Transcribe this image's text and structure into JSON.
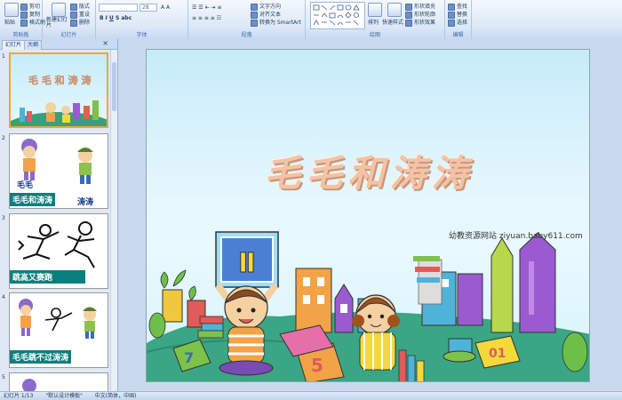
{
  "ribbon": {
    "clipboard": {
      "title": "剪贴板",
      "paste": "粘贴",
      "cut": "剪切",
      "copy": "复制",
      "format_painter": "格式刷"
    },
    "slides": {
      "title": "幻灯片",
      "new_slide": "新建幻灯片",
      "layout": "版式",
      "reset": "重设",
      "delete": "删除"
    },
    "font": {
      "title": "字体",
      "font_name": "",
      "font_size": "28"
    },
    "paragraph": {
      "title": "段落",
      "text_direction": "文字方向",
      "align_text": "对齐文本",
      "smartart": "转换为 SmartArt"
    },
    "drawing": {
      "title": "绘图",
      "arrange": "排列",
      "quick_styles": "快速样式",
      "shape_fill": "形状填充",
      "shape_outline": "形状轮廓",
      "shape_effects": "形状效果"
    },
    "editing": {
      "title": "编辑",
      "find": "查找",
      "replace": "替换",
      "select": "选择"
    }
  },
  "panel": {
    "tabs": [
      "幻灯片",
      "大纲"
    ],
    "slides": [
      {
        "num": "1",
        "label": ""
      },
      {
        "num": "2",
        "label": "毛毛和涛涛",
        "name1": "毛毛",
        "name2": "涛涛"
      },
      {
        "num": "3",
        "label": "跳高又赛跑"
      },
      {
        "num": "4",
        "label": "毛毛跳不过涛涛"
      },
      {
        "num": "5",
        "label": ""
      }
    ]
  },
  "slide": {
    "title": "毛毛和涛涛",
    "site": "幼教资源网站  ziyuan.baby611.com"
  },
  "status": {
    "slide_count": "幻灯片 1/13",
    "theme": "\"默认设计模板\"",
    "language": "中文(简体，中国)"
  },
  "colors": {
    "ribbon": "#dbe8f7",
    "label_bg": "#0b7f7f",
    "title": "#f4c2a4"
  }
}
